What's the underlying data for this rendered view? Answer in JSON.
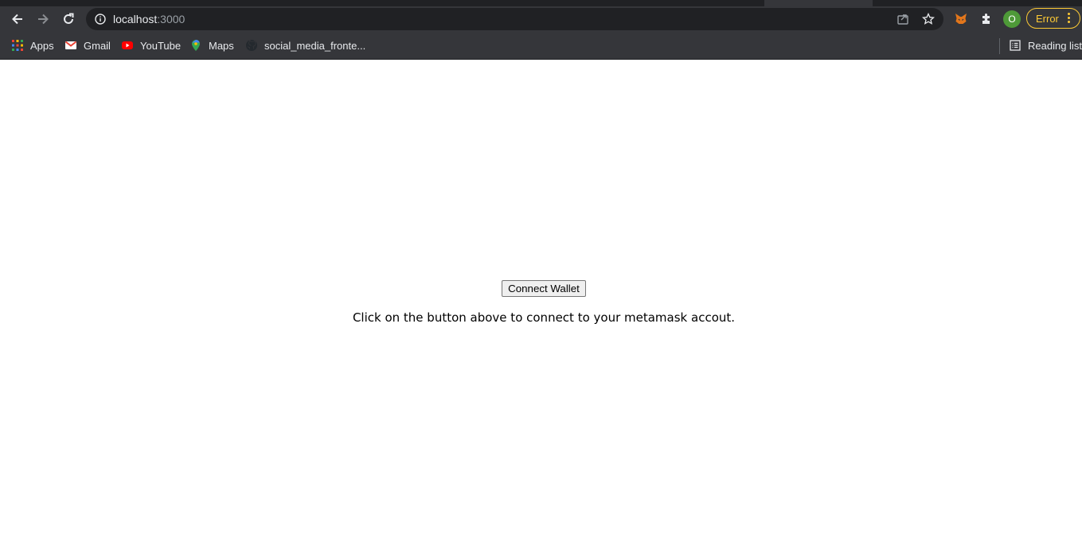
{
  "browser": {
    "url_host": "localhost",
    "url_port": ":3000",
    "profile_initial": "O",
    "error_label": "Error",
    "bookmarks": [
      {
        "label": "Apps",
        "icon": "apps-grid-icon"
      },
      {
        "label": "Gmail",
        "icon": "gmail-icon"
      },
      {
        "label": "YouTube",
        "icon": "youtube-icon"
      },
      {
        "label": "Maps",
        "icon": "maps-icon"
      },
      {
        "label": "social_media_fronte...",
        "icon": "github-icon"
      }
    ],
    "reading_list_label": "Reading list"
  },
  "page": {
    "button_label": "Connect Wallet",
    "hint_text": "Click on the button above to connect to your metamask accout."
  },
  "colors": {
    "chrome_dark": "#35363a",
    "omnibox": "#202124",
    "error_accent": "#fcc934",
    "avatar": "#4e9a38"
  }
}
